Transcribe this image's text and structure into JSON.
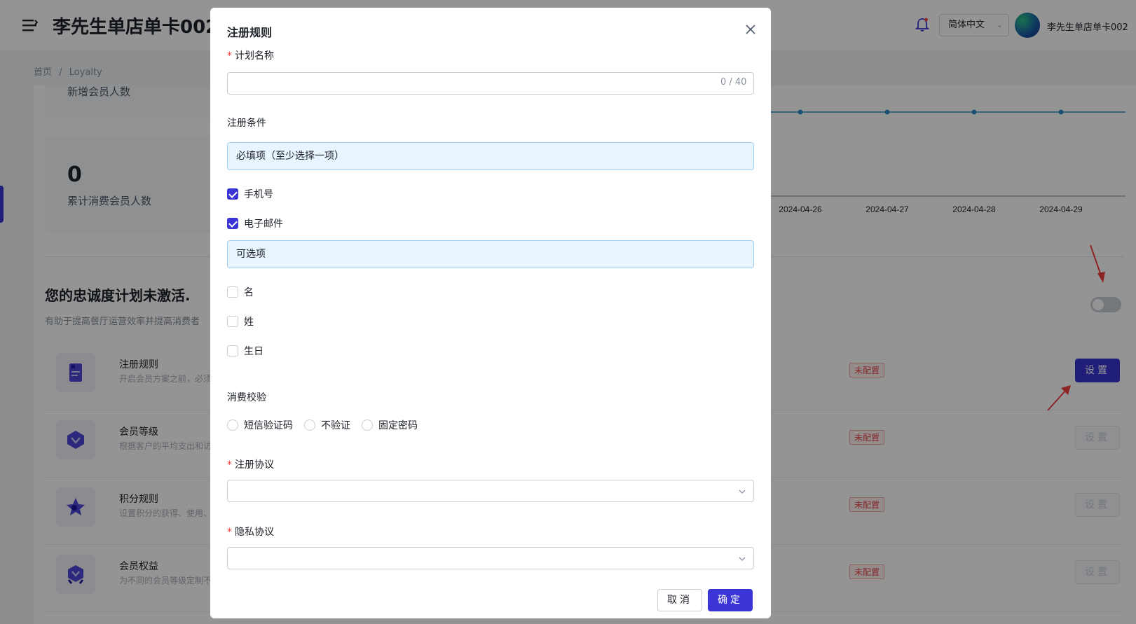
{
  "header": {
    "app_title": "李先生单店单卡002",
    "language": "简体中文",
    "user_name": "李先生单店单卡002"
  },
  "breadcrumb": {
    "home": "首页",
    "separator": "/",
    "current": "Loyalty"
  },
  "stats": {
    "new_members_label": "新增会员人数",
    "accumulated_value": "0",
    "accumulated_label": "累计消费会员人数"
  },
  "chart_data": {
    "type": "line",
    "categories": [
      "2024-04-26",
      "2024-04-27",
      "2024-04-28",
      "2024-04-29"
    ],
    "values": [
      0,
      0,
      0,
      0
    ],
    "color": "#2d8cc9"
  },
  "loyalty": {
    "title": "您的忠诚度计划未激活.",
    "subtitle": "有助于提高餐厅运营效率并提高消费者",
    "rules": [
      {
        "name": "注册规则",
        "desc": "开启会员方案之前，必须",
        "status": "未配置",
        "button": "设置",
        "active": true
      },
      {
        "name": "会员等级",
        "desc": "根据客户的平均支出和访",
        "status": "未配置",
        "button": "设置",
        "active": false
      },
      {
        "name": "积分规则",
        "desc": "设置积分的获得、使用、",
        "status": "未配置",
        "button": "设置",
        "active": false
      },
      {
        "name": "会员权益",
        "desc": "为不同的会员等级定制不",
        "status": "未配置",
        "button": "设置",
        "active": false
      }
    ]
  },
  "colors": {
    "accent": "#3a35d4",
    "danger": "#f53f3f",
    "info_bg": "#e8f4ff"
  },
  "modal": {
    "title": "注册规则",
    "plan_name": {
      "required_mark": "*",
      "label": "计划名称",
      "value": "",
      "counter": "0 / 40"
    },
    "conditions_label": "注册条件",
    "required_section": "必填项（至少选择一项）",
    "required_options": [
      {
        "label": "手机号",
        "checked": true
      },
      {
        "label": "电子邮件",
        "checked": true
      }
    ],
    "optional_section": "可选项",
    "optional_options": [
      {
        "label": "名",
        "checked": false
      },
      {
        "label": "姓",
        "checked": false
      },
      {
        "label": "生日",
        "checked": false
      }
    ],
    "verification_label": "消费校验",
    "verification_options": [
      "短信验证码",
      "不验证",
      "固定密码"
    ],
    "agreement": {
      "required_mark": "*",
      "label": "注册协议",
      "value": ""
    },
    "privacy": {
      "required_mark": "*",
      "label": "隐私协议",
      "value": ""
    },
    "cancel_label": "取消",
    "confirm_label": "确定"
  }
}
